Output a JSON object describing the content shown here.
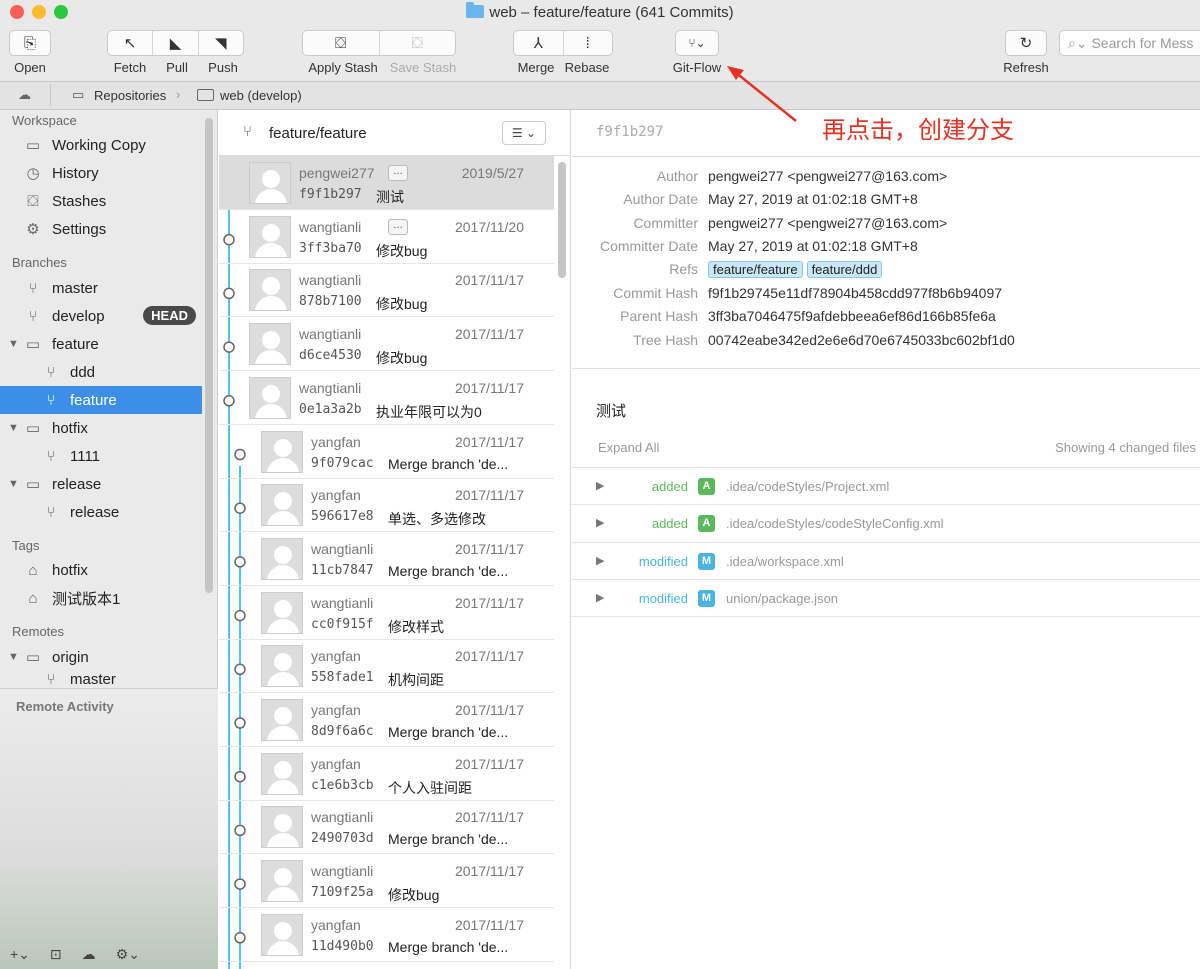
{
  "window": {
    "title": "web – feature/feature (641 Commits)"
  },
  "toolbar": {
    "open": "Open",
    "fetch": "Fetch",
    "pull": "Pull",
    "push": "Push",
    "apply_stash": "Apply Stash",
    "save_stash": "Save Stash",
    "merge": "Merge",
    "rebase": "Rebase",
    "gitflow": "Git-Flow",
    "refresh": "Refresh",
    "search_placeholder": "Search for Mess"
  },
  "pathbar": {
    "repositories": "Repositories",
    "repo": "web (develop)"
  },
  "sidebar": {
    "workspace_head": "Workspace",
    "workspace": [
      "Working Copy",
      "History",
      "Stashes",
      "Settings"
    ],
    "branches_head": "Branches",
    "master": "master",
    "develop": "develop",
    "head_badge": "HEAD",
    "feature": "feature",
    "ddd": "ddd",
    "feature_feature": "feature",
    "hotfix": "hotfix",
    "b1111": "1111",
    "release": "release",
    "release_child": "release",
    "tags_head": "Tags",
    "tags": [
      "hotfix",
      "测试版本1"
    ],
    "remotes_head": "Remotes",
    "origin": "origin",
    "origin_master": "master",
    "remote_activity": "Remote Activity"
  },
  "commit_list": {
    "branch": "feature/feature",
    "rows": [
      {
        "author": "pengwei277",
        "date": "2019/5/27",
        "hash": "f9f1b297",
        "msg": "测试",
        "more": true
      },
      {
        "author": "wangtianli",
        "date": "2017/11/20",
        "hash": "3ff3ba70",
        "msg": "修改bug",
        "more": true
      },
      {
        "author": "wangtianli",
        "date": "2017/11/17",
        "hash": "878b7100",
        "msg": "修改bug"
      },
      {
        "author": "wangtianli",
        "date": "2017/11/17",
        "hash": "d6ce4530",
        "msg": "修改bug"
      },
      {
        "author": "wangtianli",
        "date": "2017/11/17",
        "hash": "0e1a3a2b",
        "msg": "执业年限可以为0"
      },
      {
        "author": "yangfan",
        "date": "2017/11/17",
        "hash": "9f079cac",
        "msg": "Merge branch 'de..."
      },
      {
        "author": "yangfan",
        "date": "2017/11/17",
        "hash": "596617e8",
        "msg": "单选、多选修改"
      },
      {
        "author": "wangtianli",
        "date": "2017/11/17",
        "hash": "11cb7847",
        "msg": "Merge branch 'de..."
      },
      {
        "author": "wangtianli",
        "date": "2017/11/17",
        "hash": "cc0f915f",
        "msg": "修改样式"
      },
      {
        "author": "yangfan",
        "date": "2017/11/17",
        "hash": "558fade1",
        "msg": "机构间距"
      },
      {
        "author": "yangfan",
        "date": "2017/11/17",
        "hash": "8d9f6a6c",
        "msg": "Merge branch 'de..."
      },
      {
        "author": "yangfan",
        "date": "2017/11/17",
        "hash": "c1e6b3cb",
        "msg": "个人入驻间距"
      },
      {
        "author": "wangtianli",
        "date": "2017/11/17",
        "hash": "2490703d",
        "msg": "Merge branch 'de..."
      },
      {
        "author": "wangtianli",
        "date": "2017/11/17",
        "hash": "7109f25a",
        "msg": "修改bug"
      },
      {
        "author": "yangfan",
        "date": "2017/11/17",
        "hash": "11d490b0",
        "msg": "Merge branch 'de..."
      }
    ]
  },
  "detail": {
    "hash_short": "f9f1b297",
    "author_label": "Author",
    "author": "pengwei277 <pengwei277@163.com>",
    "author_date_label": "Author Date",
    "author_date": "May 27, 2019 at 01:02:18 GMT+8",
    "committer_label": "Committer",
    "committer": "pengwei277 <pengwei277@163.com>",
    "committer_date_label": "Committer Date",
    "committer_date": "May 27, 2019 at 01:02:18 GMT+8",
    "refs_label": "Refs",
    "ref1": "feature/feature",
    "ref2": "feature/ddd",
    "commit_hash_label": "Commit Hash",
    "commit_hash": "f9f1b29745e11df78904b458cdd977f8b6b94097",
    "parent_hash_label": "Parent Hash",
    "parent_hash": "3ff3ba7046475f9afdebbeea6ef86d166b85fe6a",
    "tree_hash_label": "Tree Hash",
    "tree_hash": "00742eabe342ed2e6e6d70e6745033bc602bf1d0",
    "message": "测试",
    "expand_all": "Expand All",
    "showing": "Showing 4 changed files",
    "files": [
      {
        "status": "added",
        "badge": "A",
        "path": ".idea/codeStyles/Project.xml",
        "color": "#5cb85c"
      },
      {
        "status": "added",
        "badge": "A",
        "path": ".idea/codeStyles/codeStyleConfig.xml",
        "color": "#5cb85c"
      },
      {
        "status": "modified",
        "badge": "M",
        "path": ".idea/workspace.xml",
        "color": "#4ab3e6"
      },
      {
        "status": "modified",
        "badge": "M",
        "path": "union/package.json",
        "color": "#4ab3e6"
      }
    ]
  },
  "annotation": "再点击，创建分支",
  "colors": {
    "selection": "#3d8ee7",
    "graph_line": "#4fc3f7",
    "annotation": "#e53222"
  }
}
